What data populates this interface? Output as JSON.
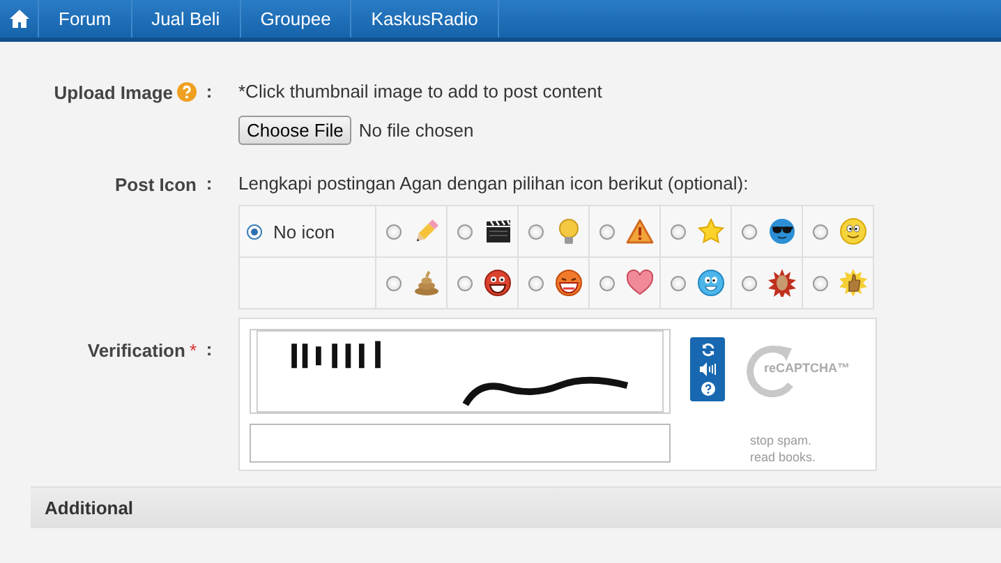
{
  "nav": {
    "items": [
      {
        "label": "Forum"
      },
      {
        "label": "Jual Beli"
      },
      {
        "label": "Groupee"
      },
      {
        "label": "KaskusRadio"
      }
    ]
  },
  "upload": {
    "label": "Upload Image",
    "colon": ":",
    "hint": "*Click thumbnail image to add to post content",
    "button": "Choose File",
    "file_status": "No file chosen"
  },
  "post_icon": {
    "label": "Post Icon",
    "colon": ":",
    "hint": "Lengkapi postingan Agan dengan pilihan icon berikut (optional):",
    "options": [
      {
        "kind": "none",
        "label": "No icon",
        "selected": true
      },
      {
        "kind": "pencil",
        "selected": false
      },
      {
        "kind": "clapperboard",
        "selected": false
      },
      {
        "kind": "bulb",
        "selected": false
      },
      {
        "kind": "warning",
        "selected": false
      },
      {
        "kind": "star",
        "selected": false
      },
      {
        "kind": "sunglasses",
        "selected": false
      },
      {
        "kind": "smiley",
        "selected": false
      },
      {
        "kind": "poop",
        "selected": false
      },
      {
        "kind": "grin",
        "selected": false
      },
      {
        "kind": "laugh",
        "selected": false
      },
      {
        "kind": "heart",
        "selected": false
      },
      {
        "kind": "blueface",
        "selected": false
      },
      {
        "kind": "burst",
        "selected": false
      },
      {
        "kind": "thumbsup",
        "selected": false
      }
    ]
  },
  "verification": {
    "label": "Verification",
    "required_mark": "*",
    "colon": ":",
    "logo": "reCAPTCHA™",
    "tagline": "stop spam. read books."
  },
  "section": {
    "title": "Additional"
  }
}
